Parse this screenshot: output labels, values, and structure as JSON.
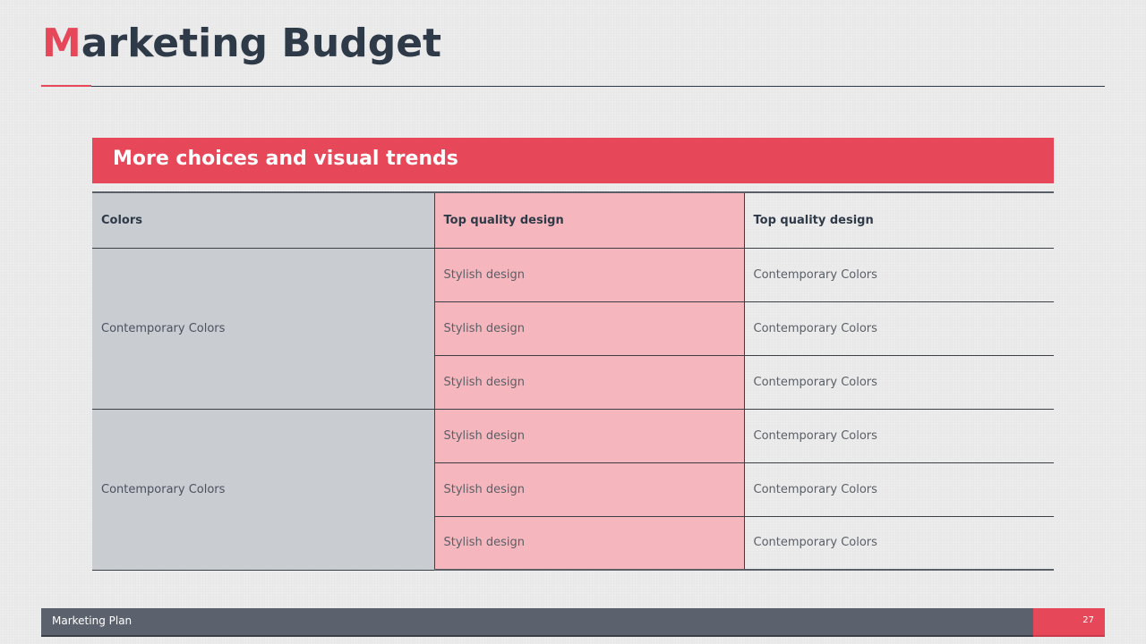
{
  "slide": {
    "title_first": "M",
    "title_rest": "arketing Budget",
    "banner": "More choices and visual trends",
    "accent_color": "#e6485a",
    "dark_color": "#2f3a48"
  },
  "table": {
    "headers": [
      "Colors",
      "Top quality design",
      "Top quality design"
    ],
    "groups": [
      {
        "label": "Contemporary Colors",
        "rows": [
          [
            "Stylish design",
            "Contemporary Colors"
          ],
          [
            "Stylish design",
            "Contemporary Colors"
          ],
          [
            "Stylish design",
            "Contemporary Colors"
          ]
        ]
      },
      {
        "label": "Contemporary Colors",
        "rows": [
          [
            "Stylish design",
            "Contemporary Colors"
          ],
          [
            "Stylish design",
            "Contemporary Colors"
          ],
          [
            "Stylish design",
            "Contemporary Colors"
          ]
        ]
      }
    ]
  },
  "footer": {
    "label": "Marketing Plan",
    "page": "27"
  }
}
